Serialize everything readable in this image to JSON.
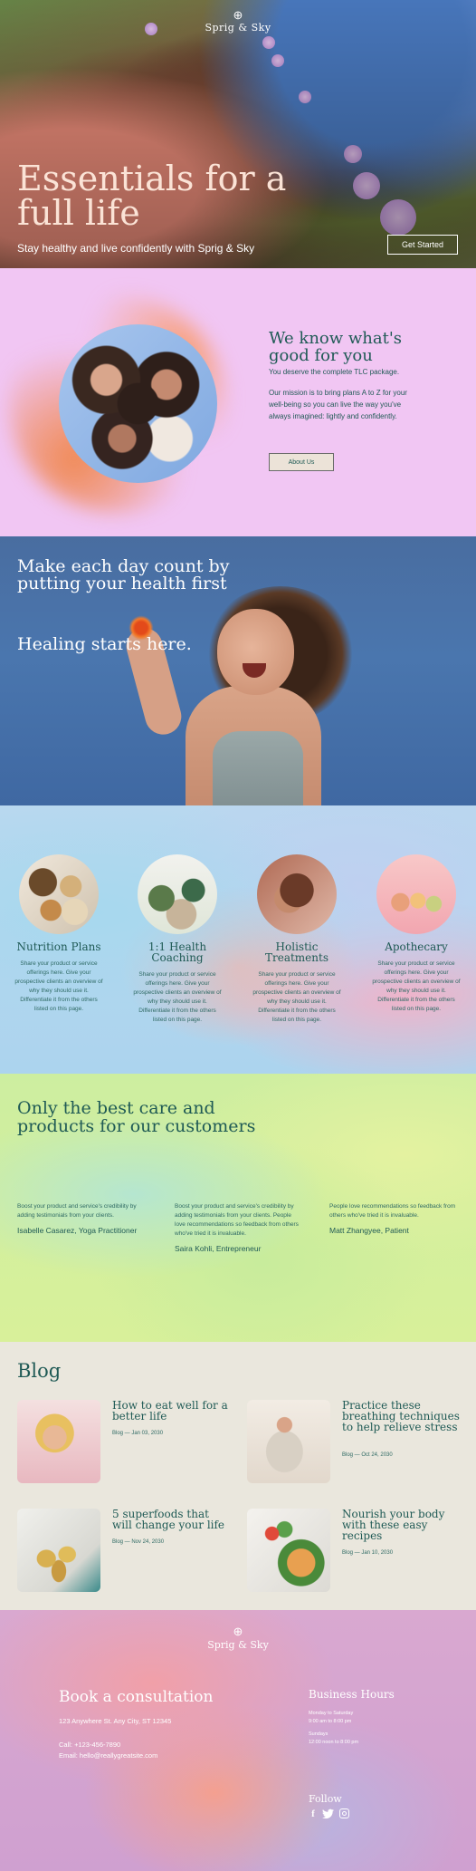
{
  "brand": {
    "name": "Sprig & Sky",
    "mark": "⊕"
  },
  "hero": {
    "headline": "Essentials for a full life",
    "subtitle": "Stay healthy and live confidently with Sprig & Sky",
    "cta": "Get Started"
  },
  "about": {
    "heading": "We know what's good for you",
    "line1": "You deserve the complete TLC package.",
    "line2": "Our mission is to bring plans A to Z for your well-being so you can live the way you've always imagined: lightly and confidently.",
    "button": "About Us"
  },
  "day": {
    "heading": "Make each day count by putting your health first",
    "subheading": "Healing starts here."
  },
  "services": [
    {
      "title": "Nutrition Plans",
      "desc": "Share your product or service offerings here. Give your prospective clients an overview of why they should use it. Differentiate it from the others listed on this page."
    },
    {
      "title": "1:1 Health Coaching",
      "desc": "Share your product or service offerings here. Give your prospective clients an overview of why they should use it. Differentiate it from the others listed on this page."
    },
    {
      "title": "Holistic Treatments",
      "desc": "Share your product or service offerings here. Give your prospective clients an overview of why they should use it. Differentiate it from the others listed on this page."
    },
    {
      "title": "Apothecary",
      "desc": "Share your product or service offerings here. Give your prospective clients an overview of why they should use it. Differentiate it from the others listed on this page."
    }
  ],
  "testimonials": {
    "heading": "Only the best care and products for our customers",
    "items": [
      {
        "quote": "Boost your product and service's credibility by adding testimonials from your clients.",
        "name": "Isabelle Casarez, Yoga Practitioner"
      },
      {
        "quote": "Boost your product and service's credibility by adding testimonials from your clients. People love recommendations so feedback from others who've tried it is invaluable.",
        "name": "Saira Kohli, Entrepreneur"
      },
      {
        "quote": "People love recommendations so feedback from others who've tried it is invaluable.",
        "name": "Matt Zhangyee, Patient"
      }
    ]
  },
  "blog": {
    "heading": "Blog",
    "posts": [
      {
        "title": "How to eat well for a better life",
        "meta": "Blog — Jan 03, 2030"
      },
      {
        "title": "Practice these breathing techniques to help relieve stress",
        "meta": "Blog — Oct 24, 2030"
      },
      {
        "title": "5 superfoods that will change your life",
        "meta": "Blog — Nov 24, 2030"
      },
      {
        "title": "Nourish your body with these easy recipes",
        "meta": "Blog — Jan 10, 2030"
      }
    ]
  },
  "footer": {
    "heading": "Book a consultation",
    "address": "123 Anywhere St. Any City, ST 12345",
    "phone": "Call: +123-456-7890",
    "email": "Email: hello@reallygreatsite.com",
    "hours_title": "Business Hours",
    "hours_weekdays_label": "Monday to Saturday",
    "hours_weekdays": "9:00 am to 8:00 pm",
    "hours_sunday_label": "Sundays",
    "hours_sunday": "12:00 noon to 8:00 pm",
    "follow": "Follow",
    "social": [
      "facebook-icon",
      "twitter-icon",
      "instagram-icon"
    ]
  },
  "colors": {
    "primary_text": "#1f5a55",
    "about_bg": "#f1c6f3",
    "day_bg": "#4a76ae",
    "blog_bg": "#eae7dd",
    "footer_bg": "#d9a8d0"
  }
}
